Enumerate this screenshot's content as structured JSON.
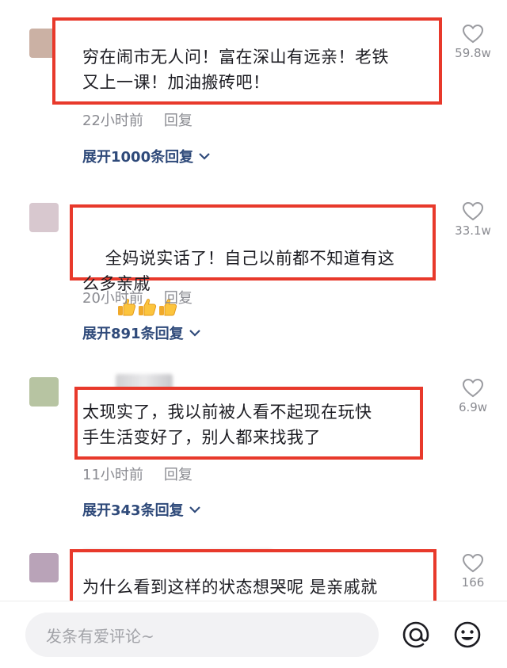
{
  "comments": [
    {
      "text": "穷在闹市无人问！富在深山有远亲！老铁\n又上一课！加油搬砖吧！",
      "time": "22小时前",
      "reply": "回复",
      "expand": "展开1000条回复",
      "likes": "59.8w",
      "avatar_color": "#cbb1a4"
    },
    {
      "text": "全妈说实话了！自己以前都不知道有这\n么多亲戚",
      "emoji": [
        "thumbs-up",
        "thumbs-up",
        "thumbs-up"
      ],
      "time": "20小时前",
      "reply": "回复",
      "expand": "展开891条回复",
      "likes": "33.1w",
      "avatar_color": "#d8c8cf"
    },
    {
      "text": "太现实了，我以前被人看不起现在玩快\n手生活变好了，别人都来找我了",
      "time": "11小时前",
      "reply": "回复",
      "expand": "展开343条回复",
      "likes": "6.9w",
      "avatar_color": "#b7c4a2"
    },
    {
      "text": "为什么看到这样的状态想哭呢 是亲戚就",
      "likes": "166",
      "avatar_color": "#b9a3b8"
    }
  ],
  "input": {
    "placeholder": "发条有爱评论~"
  },
  "icons": {
    "like": "heart-outline-icon",
    "expand": "chevron-down-icon",
    "mention": "at-icon",
    "emoji": "smiley-icon"
  },
  "colors": {
    "highlight_box": "#e8392b",
    "expand_link": "#2f4a7a",
    "meta_text": "#8a8b91"
  }
}
